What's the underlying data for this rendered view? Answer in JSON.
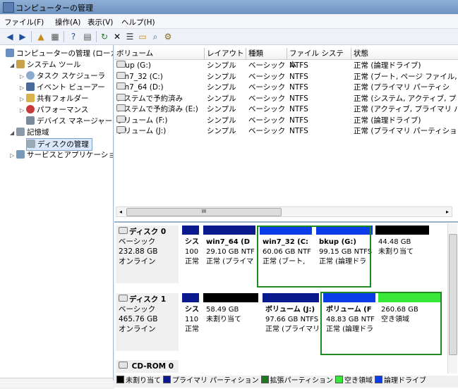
{
  "window": {
    "title": "コンピューターの管理"
  },
  "menu": [
    "ファイル(F)",
    "操作(A)",
    "表示(V)",
    "ヘルプ(H)"
  ],
  "tree": [
    {
      "label": "コンピューターの管理 (ローカ",
      "level": 0,
      "exp": ""
    },
    {
      "label": "システム ツール",
      "level": 1,
      "exp": "◢"
    },
    {
      "label": "タスク スケジューラ",
      "level": 2,
      "exp": "▷"
    },
    {
      "label": "イベント ビューアー",
      "level": 2,
      "exp": "▷"
    },
    {
      "label": "共有フォルダー",
      "level": 2,
      "exp": "▷"
    },
    {
      "label": "パフォーマンス",
      "level": 2,
      "exp": "▷"
    },
    {
      "label": "デバイス マネージャー",
      "level": 2,
      "exp": ""
    },
    {
      "label": "記憶域",
      "level": 1,
      "exp": "◢"
    },
    {
      "label": "ディスクの管理",
      "level": 2,
      "exp": "",
      "selected": true
    },
    {
      "label": "サービスとアプリケーション",
      "level": 1,
      "exp": "▷"
    }
  ],
  "volume_table": {
    "headers": [
      "ボリューム",
      "レイアウト",
      "種類",
      "ファイル システム",
      "状態"
    ],
    "rows": [
      [
        "bkup (G:)",
        "シンプル",
        "ベーシック",
        "NTFS",
        "正常 (論理ドライブ)"
      ],
      [
        "win7_32 (C:)",
        "シンプル",
        "ベーシック",
        "NTFS",
        "正常 (ブート, ページ ファイル,"
      ],
      [
        "win7_64 (D:)",
        "シンプル",
        "ベーシック",
        "NTFS",
        "正常 (プライマリ パーティシ"
      ],
      [
        "システムで予約済み",
        "シンプル",
        "ベーシック",
        "NTFS",
        "正常 (システム, アクティブ, プ"
      ],
      [
        "システムで予約済み (E:)",
        "シンプル",
        "ベーシック",
        "NTFS",
        "正常 (アクティブ, プライマリ パ"
      ],
      [
        "ボリューム (F:)",
        "シンプル",
        "ベーシック",
        "NTFS",
        "正常 (論理ドライブ)"
      ],
      [
        "ボリューム (J:)",
        "シンプル",
        "ベーシック",
        "NTFS",
        "正常 (プライマリ パーティショ"
      ]
    ]
  },
  "hscroll_label": "III",
  "disks": [
    {
      "name": "ディスク 0",
      "type": "ベーシック",
      "size": "232.88 GB",
      "status": "オンライン",
      "partitions": [
        {
          "l1": "シス",
          "l2": "100",
          "l3": "正常",
          "color": "#0a1a8c"
        },
        {
          "l1": "win7_64 (D",
          "l2": "29.10 GB NTF",
          "l3": "正常 (プライマ",
          "color": "#0a1a8c"
        },
        {
          "l1": "win7_32 (C:",
          "l2": "60.06 GB NTF",
          "l3": "正常 (ブート, ",
          "color": "#0a3de8"
        },
        {
          "l1": "bkup (G:)",
          "l2": "99.15 GB NTFS",
          "l3": "正常 (論理ドラ",
          "color": "#0a3de8"
        },
        {
          "l1": "",
          "l2": "44.48 GB",
          "l3": "未割り当て",
          "color": "#000000"
        }
      ]
    },
    {
      "name": "ディスク 1",
      "type": "ベーシック",
      "size": "465.76 GB",
      "status": "オンライン",
      "partitions": [
        {
          "l1": "シス",
          "l2": "110",
          "l3": "正常",
          "color": "#0a1a8c"
        },
        {
          "l1": "",
          "l2": "58.49 GB",
          "l3": "未割り当て",
          "color": "#000000"
        },
        {
          "l1": "ボリューム (J:)",
          "l2": "97.66 GB NTFS",
          "l3": "正常 (プライマリ",
          "color": "#0a1a8c"
        },
        {
          "l1": "ボリューム (F",
          "l2": "48.83 GB NTF",
          "l3": "正常 (論理ドラ",
          "color": "#0a3de8"
        },
        {
          "l1": "",
          "l2": "260.68 GB",
          "l3": "空き領域",
          "color": "#38e838"
        }
      ]
    }
  ],
  "cdrom": {
    "name": "CD-ROM 0"
  },
  "legend": [
    {
      "label": "未割り当て",
      "color": "#000000"
    },
    {
      "label": "プライマリ パーティション",
      "color": "#0a1a8c"
    },
    {
      "label": "拡張パーティション",
      "color": "#1f7a1f"
    },
    {
      "label": "空き領域",
      "color": "#38e838"
    },
    {
      "label": "論理ドライブ",
      "color": "#0a3de8"
    }
  ]
}
